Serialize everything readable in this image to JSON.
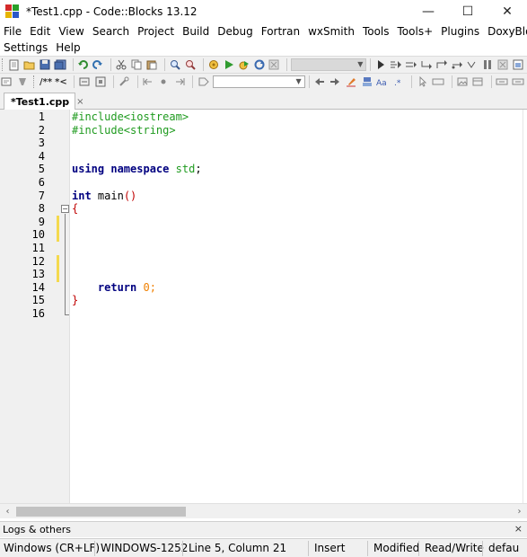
{
  "window": {
    "title": "*Test1.cpp - Code::Blocks 13.12",
    "minimize": "—",
    "maximize": "☐",
    "close": "✕"
  },
  "menu": {
    "row1": [
      "File",
      "Edit",
      "View",
      "Search",
      "Project",
      "Build",
      "Debug",
      "Fortran",
      "wxSmith",
      "Tools",
      "Tools+",
      "Plugins",
      "DoxyBlocks"
    ],
    "row2": [
      "Settings",
      "Help"
    ]
  },
  "toolbar": {
    "doxy_comment": "/**",
    "doxy_line": "*<"
  },
  "editor": {
    "tab_label": "*Test1.cpp",
    "tab_close": "×",
    "fold_symbol": "−",
    "line_numbers": [
      "1",
      "2",
      "3",
      "4",
      "5",
      "6",
      "7",
      "8",
      "9",
      "10",
      "11",
      "12",
      "13",
      "14",
      "15",
      "16"
    ],
    "lines": {
      "l1": "#include<iostream>",
      "l2": "#include<string>",
      "l5_using": "using",
      "l5_namespace": "namespace",
      "l5_std": "std",
      "l5_semi": ";",
      "l7_int": "int",
      "l7_main": "main",
      "l7_parens": "()",
      "l8_brace": "{",
      "l14_return": "return",
      "l14_zero": "0",
      "l14_semi": ";",
      "l15_brace": "}"
    }
  },
  "scroll": {
    "left": "‹",
    "right": "›"
  },
  "logs": {
    "title": "Logs & others",
    "close": "×"
  },
  "status": {
    "eol": "Windows (CR+LF)",
    "encoding": "WINDOWS-1252",
    "position": "Line 5, Column 21",
    "mode": "Insert",
    "modified": "Modified",
    "access": "Read/Write",
    "lang": "defau"
  }
}
